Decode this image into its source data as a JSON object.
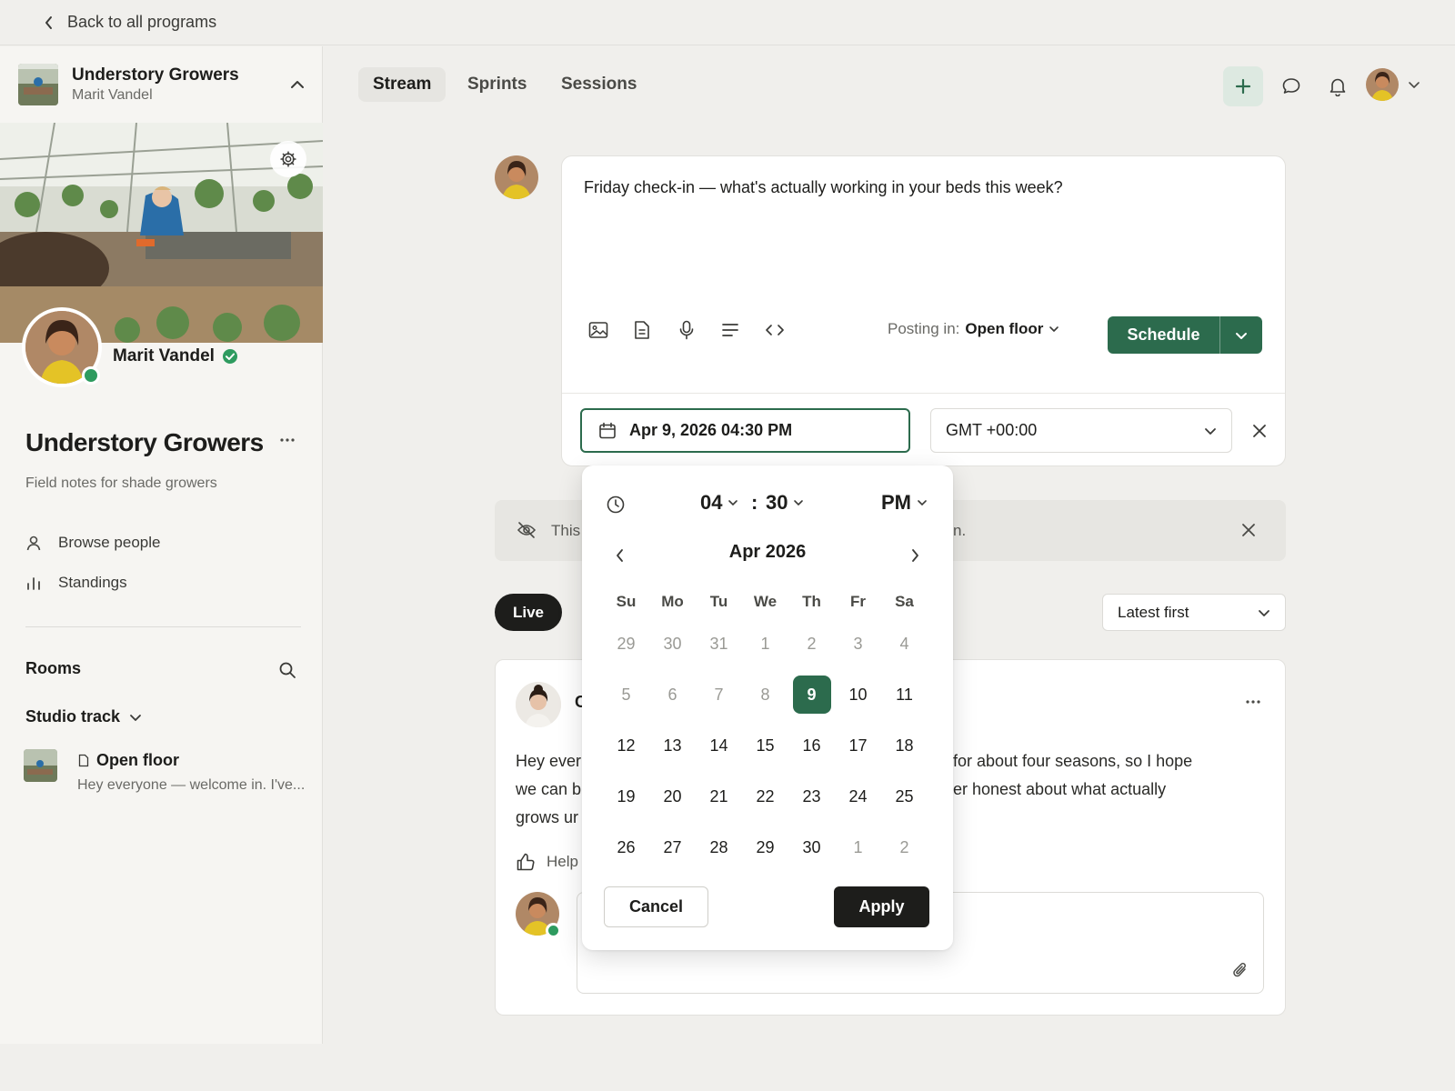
{
  "topbar": {
    "back_label": "Back to all programs"
  },
  "sidebar": {
    "group_title": "Understory Growers",
    "group_owner": "Marit Vandel",
    "owner_name": "Marit Vandel",
    "group_name": "Understory Growers",
    "group_desc": "Field notes for shade growers",
    "links": [
      {
        "label": "Browse people",
        "icon": "person-icon"
      },
      {
        "label": "Standings",
        "icon": "bar-chart-icon"
      }
    ],
    "rooms_heading": "Rooms",
    "track_label": "Studio track",
    "room": {
      "title": "Open floor",
      "preview": "Hey everyone — welcome in. I've..."
    }
  },
  "header": {
    "tabs": [
      {
        "label": "Stream"
      },
      {
        "label": "Sprints"
      },
      {
        "label": "Sessions"
      }
    ]
  },
  "composer": {
    "text": "Friday check-in — what's actually working in your beds this week?",
    "posting_prefix": "Posting in:",
    "posting_room": "Open floor",
    "schedule_label": "Schedule",
    "date_value": "Apr 9, 2026 04:30 PM",
    "timezone": "GMT +00:00"
  },
  "banner": {
    "text_left": "This",
    "text_right": "n."
  },
  "feed": {
    "live_label": "Live",
    "sort_label": "Latest first",
    "post": {
      "author_initial": "C",
      "body_left": [
        "Hey ever",
        "we can b",
        "grows ur"
      ],
      "body_right": [
        "for about four seasons, so I hope",
        "er honest about what actually",
        ""
      ],
      "helpful_label": "Help"
    }
  },
  "datepicker": {
    "hour": "04",
    "minute": "30",
    "separator": ":",
    "ampm": "PM",
    "month_label": "Apr 2026",
    "weekdays": [
      "Su",
      "Mo",
      "Tu",
      "We",
      "Th",
      "Fr",
      "Sa"
    ],
    "days": [
      {
        "d": "29",
        "m": true
      },
      {
        "d": "30",
        "m": true
      },
      {
        "d": "31",
        "m": true
      },
      {
        "d": "1",
        "m": true
      },
      {
        "d": "2",
        "m": true
      },
      {
        "d": "3",
        "m": true
      },
      {
        "d": "4",
        "m": true
      },
      {
        "d": "5",
        "m": true
      },
      {
        "d": "6",
        "m": true
      },
      {
        "d": "7",
        "m": true
      },
      {
        "d": "8",
        "m": true
      },
      {
        "d": "9",
        "s": true
      },
      {
        "d": "10"
      },
      {
        "d": "11"
      },
      {
        "d": "12"
      },
      {
        "d": "13"
      },
      {
        "d": "14"
      },
      {
        "d": "15"
      },
      {
        "d": "16"
      },
      {
        "d": "17"
      },
      {
        "d": "18"
      },
      {
        "d": "19"
      },
      {
        "d": "20"
      },
      {
        "d": "21"
      },
      {
        "d": "22"
      },
      {
        "d": "23"
      },
      {
        "d": "24"
      },
      {
        "d": "25"
      },
      {
        "d": "26"
      },
      {
        "d": "27"
      },
      {
        "d": "28"
      },
      {
        "d": "29"
      },
      {
        "d": "30"
      },
      {
        "d": "1",
        "m": true
      },
      {
        "d": "2",
        "m": true
      }
    ],
    "cancel_label": "Cancel",
    "apply_label": "Apply"
  },
  "colors": {
    "accent": "#2c6b4d",
    "online": "#2e9b5f",
    "dark": "#1d1d1b"
  }
}
